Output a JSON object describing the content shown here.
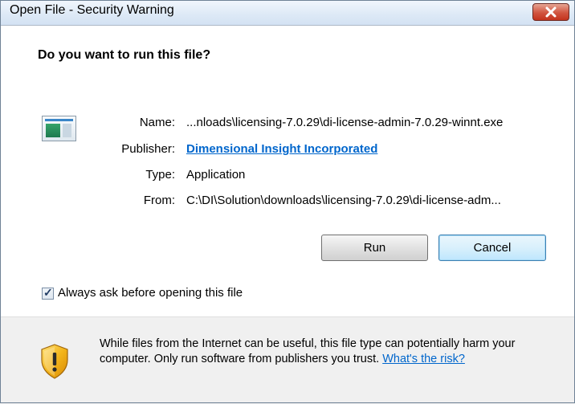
{
  "window": {
    "title": "Open File - Security Warning",
    "close_symbol": "✕"
  },
  "dialog": {
    "heading": "Do you want to run this file?",
    "fields": {
      "name_label": "Name:",
      "name_value": "...nloads\\licensing-7.0.29\\di-license-admin-7.0.29-winnt.exe",
      "publisher_label": "Publisher:",
      "publisher_value": "Dimensional Insight Incorporated",
      "type_label": "Type:",
      "type_value": "Application",
      "from_label": "From:",
      "from_value": "C:\\DI\\Solution\\downloads\\licensing-7.0.29\\di-license-adm..."
    },
    "buttons": {
      "run": "Run",
      "cancel": "Cancel"
    },
    "checkbox": {
      "label": "Always ask before opening this file",
      "checked": true,
      "mark": "✓"
    },
    "warning": {
      "text": "While files from the Internet can be useful, this file type can potentially harm your computer. Only run software from publishers you trust.",
      "link": "What's the risk?"
    }
  },
  "colors": {
    "link": "#0066cc",
    "close_button": "#c3331d",
    "footer_bg": "#f0f0f0"
  },
  "icons": {
    "file": "application-file-icon",
    "warning": "security-shield-icon",
    "close": "close-icon"
  }
}
